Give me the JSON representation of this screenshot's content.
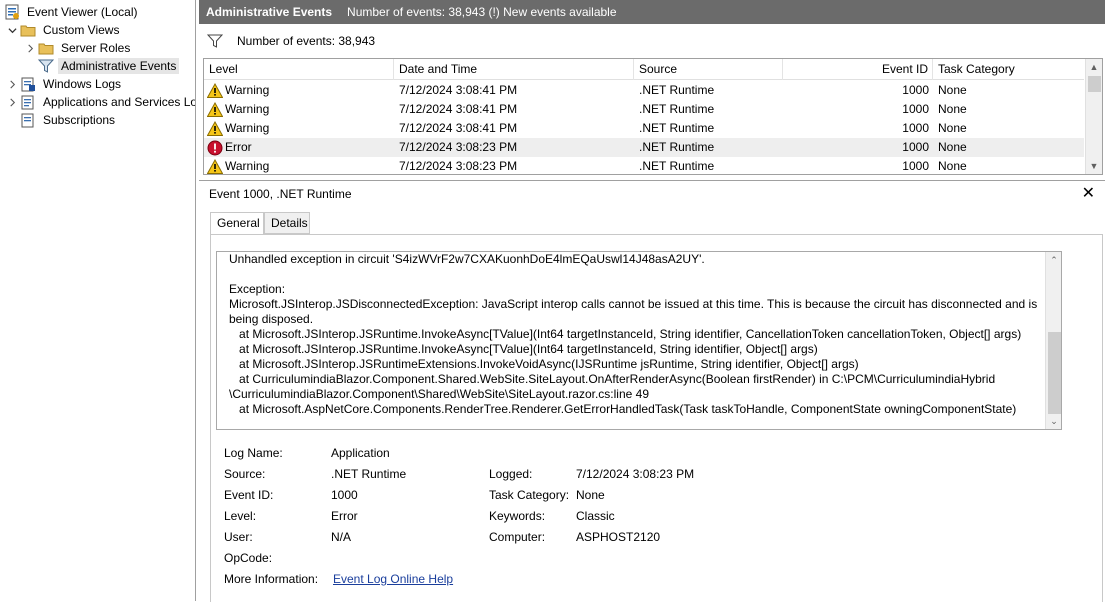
{
  "tree": {
    "root": "Event Viewer (Local)",
    "custom_views": "Custom Views",
    "server_roles": "Server Roles",
    "administrative_events": "Administrative Events",
    "windows_logs": "Windows Logs",
    "apps_services": "Applications and Services Lo",
    "subscriptions": "Subscriptions"
  },
  "header": {
    "title": "Administrative Events",
    "subtitle": "Number of events: 38,943 (!) New events available"
  },
  "filter": {
    "count_label": "Number of events: 38,943"
  },
  "grid": {
    "columns": {
      "level": "Level",
      "datetime": "Date and Time",
      "source": "Source",
      "event_id": "Event ID",
      "task_category": "Task Category"
    },
    "rows": [
      {
        "level": "Warning",
        "icon": "warning-icon",
        "datetime": "7/12/2024 3:08:41 PM",
        "source": ".NET Runtime",
        "event_id": "1000",
        "task_category": "None"
      },
      {
        "level": "Warning",
        "icon": "warning-icon",
        "datetime": "7/12/2024 3:08:41 PM",
        "source": ".NET Runtime",
        "event_id": "1000",
        "task_category": "None"
      },
      {
        "level": "Warning",
        "icon": "warning-icon",
        "datetime": "7/12/2024 3:08:41 PM",
        "source": ".NET Runtime",
        "event_id": "1000",
        "task_category": "None"
      },
      {
        "level": "Error",
        "icon": "error-icon",
        "datetime": "7/12/2024 3:08:23 PM",
        "source": ".NET Runtime",
        "event_id": "1000",
        "task_category": "None"
      },
      {
        "level": "Warning",
        "icon": "warning-icon",
        "datetime": "7/12/2024 3:08:23 PM",
        "source": ".NET Runtime",
        "event_id": "1000",
        "task_category": "None"
      }
    ],
    "selected_row": 3
  },
  "details": {
    "title": "Event 1000, .NET Runtime",
    "tabs": {
      "general": "General",
      "details": "Details"
    },
    "message_lines": [
      "Unhandled exception in circuit 'S4izWVrF2w7CXAKuonhDoE4lmEQaUswl14J48asA2UY'.",
      "",
      "Exception:",
      "Microsoft.JSInterop.JSDisconnectedException: JavaScript interop calls cannot be issued at this time. This is because the circuit has disconnected and is",
      "being disposed.",
      "   at Microsoft.JSInterop.JSRuntime.InvokeAsync[TValue](Int64 targetInstanceId, String identifier, CancellationToken cancellationToken, Object[] args)",
      "   at Microsoft.JSInterop.JSRuntime.InvokeAsync[TValue](Int64 targetInstanceId, String identifier, Object[] args)",
      "   at Microsoft.JSInterop.JSRuntimeExtensions.InvokeVoidAsync(IJSRuntime jsRuntime, String identifier, Object[] args)",
      "   at CurriculumindiaBlazor.Component.Shared.WebSite.SiteLayout.OnAfterRenderAsync(Boolean firstRender) in C:\\PCM\\CurriculumindiaHybrid",
      "\\CurriculumindiaBlazor.Component\\Shared\\WebSite\\SiteLayout.razor.cs:line 49",
      "   at Microsoft.AspNetCore.Components.RenderTree.Renderer.GetErrorHandledTask(Task taskToHandle, ComponentState owningComponentState)"
    ],
    "props": {
      "log_name_label": "Log Name:",
      "log_name": "Application",
      "source_label": "Source:",
      "source": ".NET Runtime",
      "logged_label": "Logged:",
      "logged": "7/12/2024 3:08:23 PM",
      "event_id_label": "Event ID:",
      "event_id": "1000",
      "task_category_label": "Task Category:",
      "task_category": "None",
      "level_label": "Level:",
      "level": "Error",
      "keywords_label": "Keywords:",
      "keywords": "Classic",
      "user_label": "User:",
      "user": "N/A",
      "computer_label": "Computer:",
      "computer": "ASPHOST2120",
      "opcode_label": "OpCode:",
      "opcode": "",
      "more_info_label": "More Information:",
      "more_info_link": "Event Log Online Help"
    }
  },
  "colors": {
    "titlebar": "#6b6b6b",
    "link": "#1a3e9c",
    "selected_row": "#eeeeee"
  }
}
